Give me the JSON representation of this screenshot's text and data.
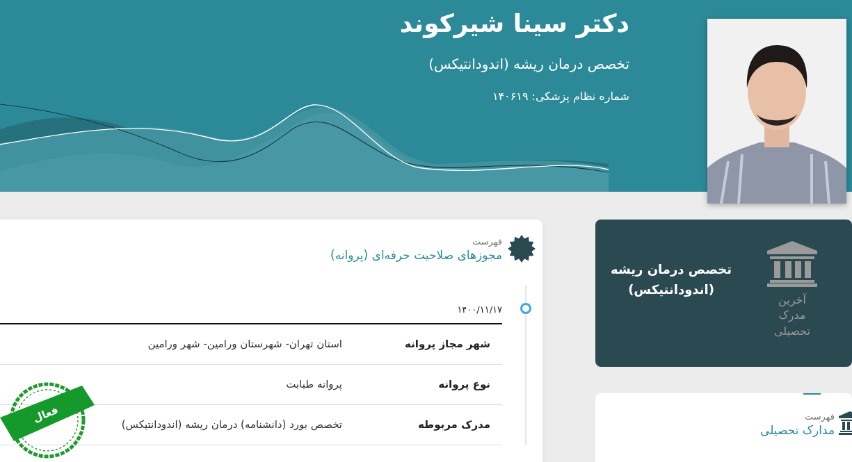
{
  "doctor": {
    "name": "دکتر سینا شیرکوند",
    "specialty": "تخصص درمان ریشه (اندودانتیکس)",
    "license_number": "شماره نظام پزشکی: ۱۴۰۶۱۹"
  },
  "licenses": {
    "caption": "فهرست",
    "title": "مجوزهای صلاحیت حرفه‌ای (پروانه)",
    "entries": [
      {
        "date": "۱۴۰۰/۱۱/۱۷",
        "status": "فعال",
        "rows": [
          {
            "label": "شهر مجاز پروانه",
            "value": "استان تهران- شهرستان ورامین- شهر ورامین"
          },
          {
            "label": "نوع پروانه",
            "value": "پروانه طبابت"
          },
          {
            "label": "مدرک مربوطه",
            "value": "تخصص بورد (دانشنامه) درمان ریشه (اندودانتیکس)"
          }
        ]
      }
    ]
  },
  "latest_degree": {
    "label": "آخرین مدرک تحصیلی",
    "title": "تخصص درمان ریشه (اندودانتیکس)"
  },
  "degrees": {
    "caption": "فهرست",
    "title": "مدارک تحصیلی"
  }
}
